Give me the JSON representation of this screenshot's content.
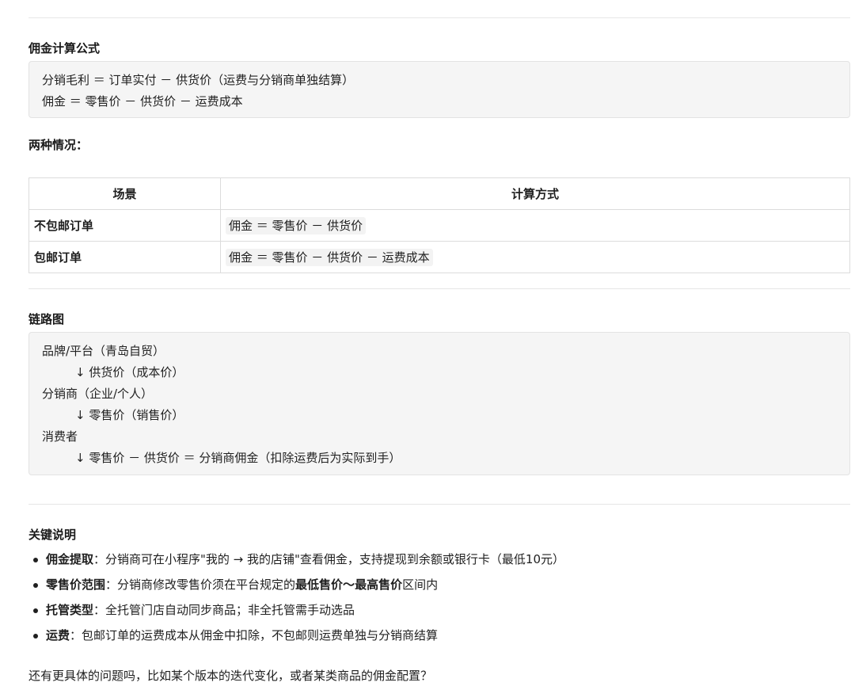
{
  "formula": {
    "heading": "佣金计算公式",
    "lines": [
      "分销毛利 ＝ 订单实付 － 供货价（运费与分销商单独结算）",
      "佣金 ＝ 零售价 － 供货价 － 运费成本"
    ]
  },
  "cases": {
    "heading": "两种情况：",
    "columns": [
      "场景",
      "计算方式"
    ],
    "rows": [
      {
        "scene": "不包邮订单",
        "method": "佣金 ＝ 零售价 － 供货价"
      },
      {
        "scene": "包邮订单",
        "method": "佣金 ＝ 零售价 － 供货价 － 运费成本"
      }
    ]
  },
  "chain": {
    "heading": "链路图",
    "lines": [
      "品牌/平台（青岛自贸）",
      "↓ 供货价（成本价）",
      "分销商（企业/个人）",
      "↓ 零售价（销售价）",
      "消费者",
      "↓ 零售价 － 供货价 ＝ 分销商佣金（扣除运费后为实际到手）"
    ]
  },
  "notes": {
    "heading": "关键说明",
    "items": [
      {
        "label": "佣金提取",
        "text": "：分销商可在小程序\"我的 → 我的店铺\"查看佣金，支持提现到余额或银行卡（最低10元）"
      },
      {
        "label": "零售价范围",
        "text_before": "：分销商修改零售价须在平台规定的",
        "bold1": "最低售价",
        "tilde": "～",
        "bold2": "最高售价",
        "text_after": "区间内"
      },
      {
        "label": "托管类型",
        "text": "：全托管门店自动同步商品；非全托管需手动选品"
      },
      {
        "label": "运费",
        "text": "：包邮订单的运费成本从佣金中扣除，不包邮则运费单独与分销商结算"
      }
    ]
  },
  "closing": "还有更具体的问题吗，比如某个版本的迭代变化，或者某类商品的佣金配置？"
}
